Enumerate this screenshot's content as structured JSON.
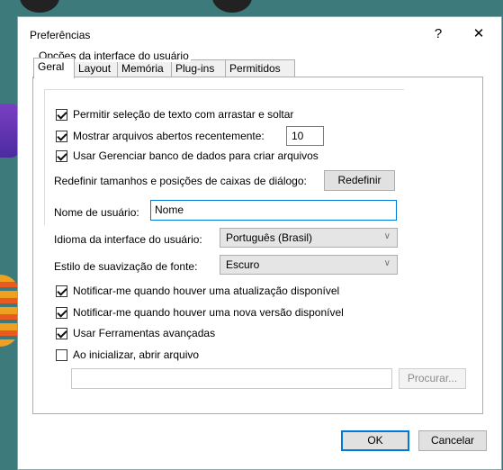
{
  "dialog": {
    "title": "Preferências",
    "help_label": "?",
    "close_label": "✕"
  },
  "tabs": [
    {
      "label": "Geral",
      "active": true
    },
    {
      "label": "Layout",
      "active": false
    },
    {
      "label": "Memória",
      "active": false
    },
    {
      "label": "Plug-ins",
      "active": false
    },
    {
      "label": "Permitidos",
      "active": false
    }
  ],
  "general": {
    "group_title": "Opções da interface do usuário",
    "allow_text_selection": {
      "label": "Permitir seleção de texto com arrastar e soltar",
      "checked": true
    },
    "show_recent_files": {
      "label": "Mostrar arquivos abertos recentemente:",
      "checked": true,
      "value": "10"
    },
    "use_database_manager": {
      "label": "Usar Gerenciar banco de dados para criar arquivos",
      "checked": true
    },
    "reset_dialogs": {
      "label": "Redefinir tamanhos e posições de caixas de diálogo:",
      "button_label": "Redefinir"
    },
    "user_name": {
      "label": "Nome de usuário:",
      "value": "Nome"
    },
    "ui_language": {
      "label": "Idioma da interface do usuário:",
      "value": "Português (Brasil)"
    },
    "font_smoothing": {
      "label": "Estilo de suavização de fonte:",
      "value": "Escuro"
    },
    "notify_update": {
      "label": "Notificar-me quando houver uma atualização disponível",
      "checked": true
    },
    "notify_version": {
      "label": "Notificar-me quando houver uma nova versão disponível",
      "checked": true
    },
    "advanced_tools": {
      "label": "Usar Ferramentas avançadas",
      "checked": true
    },
    "open_on_start": {
      "label": "Ao inicializar, abrir arquivo",
      "checked": false,
      "file_value": "",
      "browse_label": "Procurar..."
    }
  },
  "footer": {
    "ok_label": "OK",
    "cancel_label": "Cancelar"
  }
}
